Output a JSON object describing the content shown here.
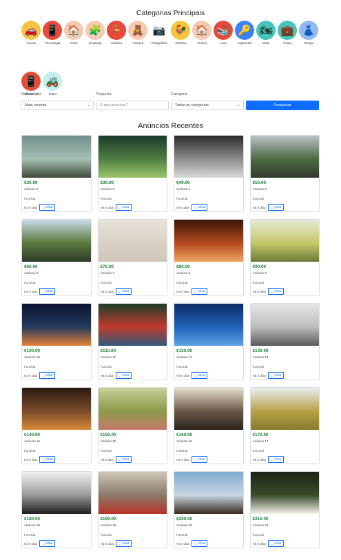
{
  "categories_title": "Categorias Principais",
  "categories": [
    {
      "label": "Carros",
      "icon": "car-icon",
      "glyph": "🚗",
      "bg": "#f5c542"
    },
    {
      "label": "Tecnologia",
      "icon": "phone-icon",
      "glyph": "📱",
      "bg": "#e84a3a"
    },
    {
      "label": "Casa",
      "icon": "house-icon",
      "glyph": "🏠",
      "bg": "#f6c9b3"
    },
    {
      "label": "Emprego",
      "icon": "boxes-icon",
      "glyph": "🧩",
      "bg": "#f6c9b3"
    },
    {
      "label": "Cadeira",
      "icon": "chair-icon",
      "glyph": "🪑",
      "bg": "#e84a3a"
    },
    {
      "label": "Criança",
      "icon": "toys-icon",
      "glyph": "🧸",
      "bg": "#f6c9b3"
    },
    {
      "label": "Fotográfica",
      "icon": "camera-icon",
      "glyph": "📷",
      "bg": "#ffffff"
    },
    {
      "label": "Galinha",
      "icon": "rooster-icon",
      "glyph": "🐓",
      "bg": "#f5c542"
    },
    {
      "label": "Imóvel",
      "icon": "building-icon",
      "glyph": "🏠",
      "bg": "#f6c9b3"
    },
    {
      "label": "Livro",
      "icon": "books-icon",
      "glyph": "📚",
      "bg": "#e84a3a"
    },
    {
      "label": "Lojamento",
      "icon": "key-icon",
      "glyph": "🔑",
      "bg": "#3b82f6"
    },
    {
      "label": "Mota",
      "icon": "motorbike-icon",
      "glyph": "🏍",
      "bg": "#46c5b9"
    },
    {
      "label": "Pasta",
      "icon": "briefcase-icon",
      "glyph": "💼",
      "bg": "#46c5b9"
    },
    {
      "label": "Roupa",
      "icon": "dress-icon",
      "glyph": "👗",
      "bg": "#93b6f5"
    },
    {
      "label": "Telemóvel",
      "icon": "mobile-icon",
      "glyph": "📱",
      "bg": "#e84a3a"
    },
    {
      "label": "Trator",
      "icon": "tractor-icon",
      "glyph": "🚜",
      "bg": "#c6eef0"
    }
  ],
  "filters": {
    "order_label": "Ordenar por",
    "order_value": "Mais recente",
    "search_label": "Pesquisa",
    "search_placeholder": "O que procuras?",
    "category_label": "Categoria",
    "category_value": "Todas as categorias",
    "search_button": "Pesquisar"
  },
  "ads_title": "Anúncios Recentes",
  "ads": [
    {
      "price": "€20.00",
      "title": "Anúncio 2",
      "location": "Funchal",
      "time": "Há 0 dias",
      "chat": "Chat",
      "img": "lake-pier",
      "colors": [
        "#6f8f8c",
        "#a7c0b4",
        "#3e4a3c"
      ]
    },
    {
      "price": "€30.00",
      "title": "Anúncio 3",
      "location": "Funchal",
      "time": "Há 0 dias",
      "chat": "Chat",
      "img": "grass",
      "colors": [
        "#1c3a2a",
        "#4f7d43",
        "#9cc46a"
      ]
    },
    {
      "price": "€40.00",
      "title": "Anúncio 4",
      "location": "Funchal",
      "time": "Há 0 dias",
      "chat": "Chat",
      "img": "bw-lake",
      "colors": [
        "#2b2b2b",
        "#8c8c8c",
        "#d9d9d9"
      ]
    },
    {
      "price": "€50.00",
      "title": "Anúncio 5",
      "location": "Funchal",
      "time": "Há 0 dias",
      "chat": "Chat",
      "img": "valley-road",
      "colors": [
        "#b9c2c6",
        "#4f6a45",
        "#2f3b2c"
      ]
    },
    {
      "price": "€60.00",
      "title": "Anúncio 6",
      "location": "Funchal",
      "time": "Há 0 dias",
      "chat": "Chat",
      "img": "coast-cliff",
      "colors": [
        "#c9dbe8",
        "#5b7a3d",
        "#2f3b2a"
      ]
    },
    {
      "price": "€70.00",
      "title": "Anúncio 7",
      "location": "Funchal",
      "time": "Há 0 dias",
      "chat": "Chat",
      "img": "beige-wall",
      "colors": [
        "#e8e3da",
        "#d8d1c4",
        "#cfc7b8"
      ]
    },
    {
      "price": "€80.00",
      "title": "Anúncio 8",
      "location": "Funchal",
      "time": "Há 0 dias",
      "chat": "Chat",
      "img": "canyon",
      "colors": [
        "#3b1608",
        "#b3471d",
        "#f0a565"
      ]
    },
    {
      "price": "€90.00",
      "title": "Anúncio 9",
      "location": "Funchal",
      "time": "Há 0 dias",
      "chat": "Chat",
      "img": "leaf",
      "colors": [
        "#e6ead6",
        "#c5c96a",
        "#6b7a36"
      ]
    },
    {
      "price": "€100.00",
      "title": "Anúncio 10",
      "location": "Funchal",
      "time": "Há 0 dias",
      "chat": "Chat",
      "img": "sunset",
      "colors": [
        "#0b1430",
        "#23395d",
        "#e5843a"
      ]
    },
    {
      "price": "€110.00",
      "title": "Anúncio 11",
      "location": "Funchal",
      "time": "Há 0 dias",
      "chat": "Chat",
      "img": "photographer",
      "colors": [
        "#1e3d2a",
        "#c23a2e",
        "#2e5a7a"
      ]
    },
    {
      "price": "€120.00",
      "title": "Anúncio 12",
      "location": "Funchal",
      "time": "Há 0 dias",
      "chat": "Chat",
      "img": "ocean-wave",
      "colors": [
        "#0c2c66",
        "#1f62b8",
        "#5fa3e6"
      ]
    },
    {
      "price": "€130.00",
      "title": "Anúncio 13",
      "location": "Funchal",
      "time": "Há 0 dias",
      "chat": "Chat",
      "img": "fog",
      "colors": [
        "#e6e6e6",
        "#bdbdbd",
        "#5a5a5a"
      ]
    },
    {
      "price": "€140.00",
      "title": "Anúncio 14",
      "location": "Funchal",
      "time": "Há 0 dias",
      "chat": "Chat",
      "img": "bar",
      "colors": [
        "#2a1a12",
        "#7a4a2a",
        "#d98a3a"
      ]
    },
    {
      "price": "€150.00",
      "title": "Anúncio 15",
      "location": "Funchal",
      "time": "Há 0 dias",
      "chat": "Chat",
      "img": "wheat",
      "colors": [
        "#c9cf9a",
        "#8a9a4a",
        "#c77a6a"
      ]
    },
    {
      "price": "€160.00",
      "title": "Anúncio 16",
      "location": "Funchal",
      "time": "Há 0 dias",
      "chat": "Chat",
      "img": "escalator",
      "colors": [
        "#e8e0d0",
        "#6b5a48",
        "#2a221c"
      ]
    },
    {
      "price": "€170.00",
      "title": "Anúncio 17",
      "location": "Funchal",
      "time": "Há 0 dias",
      "chat": "Chat",
      "img": "field",
      "colors": [
        "#e9edf0",
        "#b9a34a",
        "#8a7a2a"
      ]
    },
    {
      "price": "€180.00",
      "title": "Anúncio 18",
      "location": "Funchal",
      "time": "Há 0 dias",
      "chat": "Chat",
      "img": "bw-window",
      "colors": [
        "#f2f2f2",
        "#9a9a9a",
        "#1f1f1f"
      ]
    },
    {
      "price": "€190.00",
      "title": "Anúncio 19",
      "location": "Funchal",
      "time": "Há 0 dias",
      "chat": "Chat",
      "img": "tram-street",
      "colors": [
        "#cfc6b8",
        "#8a7a6a",
        "#b8332a"
      ]
    },
    {
      "price": "€200.00",
      "title": "Anúncio 20",
      "location": "Funchal",
      "time": "Há 0 dias",
      "chat": "Chat",
      "img": "harbor-crane",
      "colors": [
        "#7fa9cf",
        "#c9d8e4",
        "#3a2a1e"
      ]
    },
    {
      "price": "€210.00",
      "title": "Anúncio 21",
      "location": "Funchal",
      "time": "Há 0 dias",
      "chat": "Chat",
      "img": "calla-lily",
      "colors": [
        "#1c2416",
        "#3a4a2a",
        "#f2f2ea"
      ]
    }
  ]
}
